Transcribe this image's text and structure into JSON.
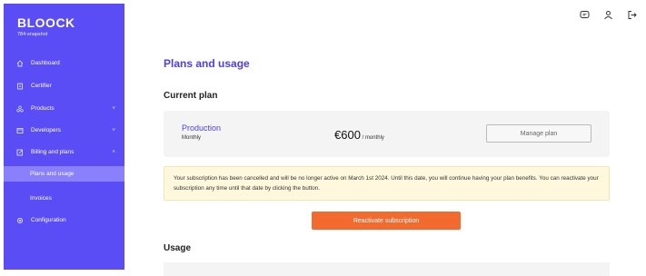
{
  "sidebar": {
    "logo": "BLOOCK",
    "version": "784-snapshot",
    "items": [
      {
        "label": "Dashboard",
        "icon": "home-icon"
      },
      {
        "label": "Certifier",
        "icon": "certifier-icon"
      },
      {
        "label": "Products",
        "icon": "products-icon",
        "chevron": "˅"
      },
      {
        "label": "Developers",
        "icon": "developers-icon",
        "chevron": "˅"
      },
      {
        "label": "Billing and plans",
        "icon": "billing-icon",
        "chevron": "˄"
      },
      {
        "label": "Plans and usage",
        "active": true
      },
      {
        "label": "Invoices"
      },
      {
        "label": "Configuration",
        "icon": "gear-icon"
      }
    ]
  },
  "topbar": {
    "icons": [
      "chat-icon",
      "user-icon",
      "logout-icon"
    ]
  },
  "main": {
    "page_title": "Plans and usage",
    "current_plan_title": "Current plan",
    "plan": {
      "name": "Production",
      "period": "Monthly",
      "price": "€600",
      "per": " / monthly",
      "manage_label": "Manage plan"
    },
    "notice": "Your subscription has been cancelled and will be no longer active on March 1st 2024. Until this date, you will continue having your plan benefits. You can reactivate your subscription any time until that date by clicking the button.",
    "reactivate_label": "Reactivate subscription",
    "usage_title": "Usage"
  },
  "colors": {
    "sidebar": "#5a4df5",
    "accent": "#4b3ff0",
    "active_item": "#8a80fb",
    "cta": "#f26a2e",
    "notice_bg": "#fff8dc"
  }
}
